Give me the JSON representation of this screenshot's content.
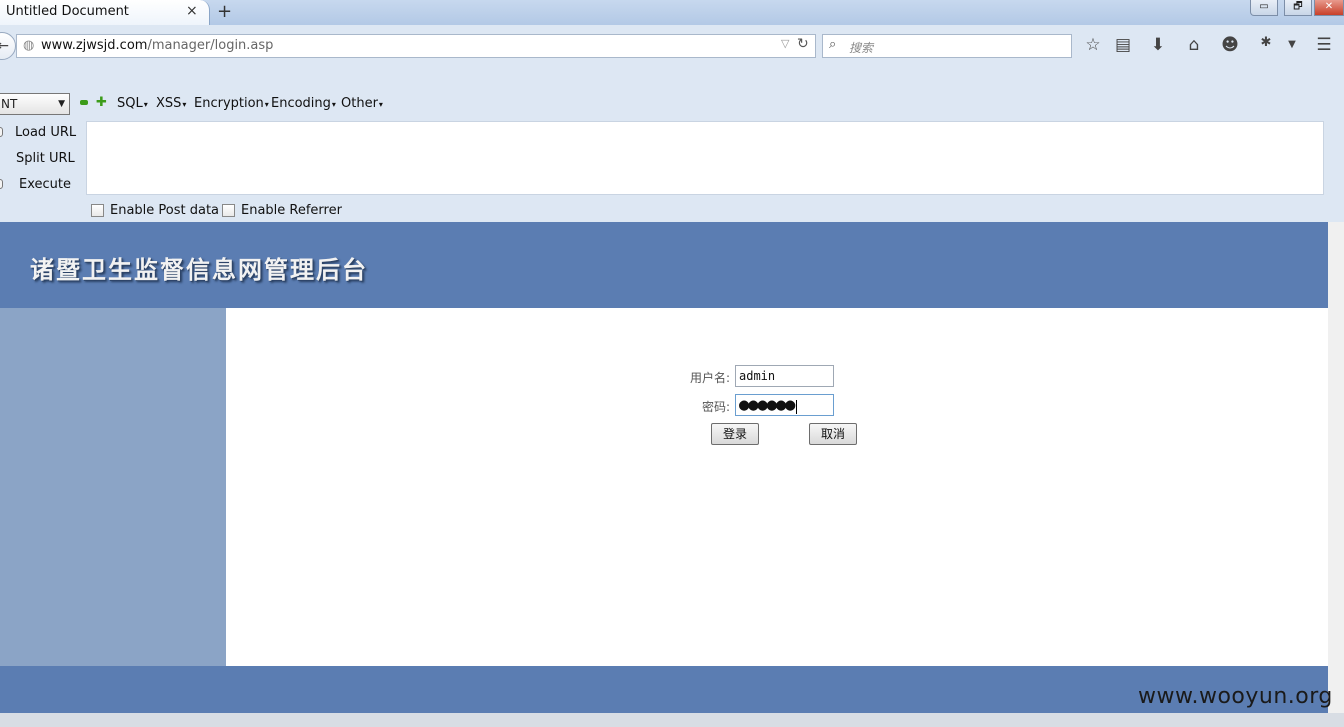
{
  "browser": {
    "tab_title": "Untitled Document",
    "tab_close": "×",
    "new_tab": "+",
    "window_controls": {
      "minimize": "▭",
      "maximize": "🗗",
      "close": "✕"
    },
    "url_host": "www.zjwsjd.com",
    "url_path": "/manager/login.asp",
    "search_placeholder": "搜索",
    "nav_icons": [
      "bookmark-star-icon",
      "reading-list-icon",
      "download-icon",
      "home-icon",
      "chat-icon",
      "extension-bug-icon",
      "dropdown-icon",
      "menu-icon"
    ]
  },
  "hackbar": {
    "select_value": "NT",
    "menu": {
      "sql": "SQL",
      "xss": "XSS",
      "encryption": "Encryption",
      "encoding": "Encoding",
      "other": "Other"
    },
    "load_url": "Load URL",
    "split_url": "Split URL",
    "execute": "Execute",
    "enable_post": "Enable Post data",
    "enable_referrer": "Enable Referrer"
  },
  "page": {
    "title": "诸暨卫生监督信息网管理后台",
    "username_label": "用户名:",
    "username_value": "admin",
    "password_label": "密码:",
    "password_dots": "●●●●●●",
    "login_button": "登录",
    "cancel_button": "取消"
  },
  "watermark": "www.wooyun.org",
  "colors": {
    "header_blue": "#5b7db2",
    "sidebar_blue": "#8ba4c6",
    "browser_chrome": "#dde7f3"
  }
}
